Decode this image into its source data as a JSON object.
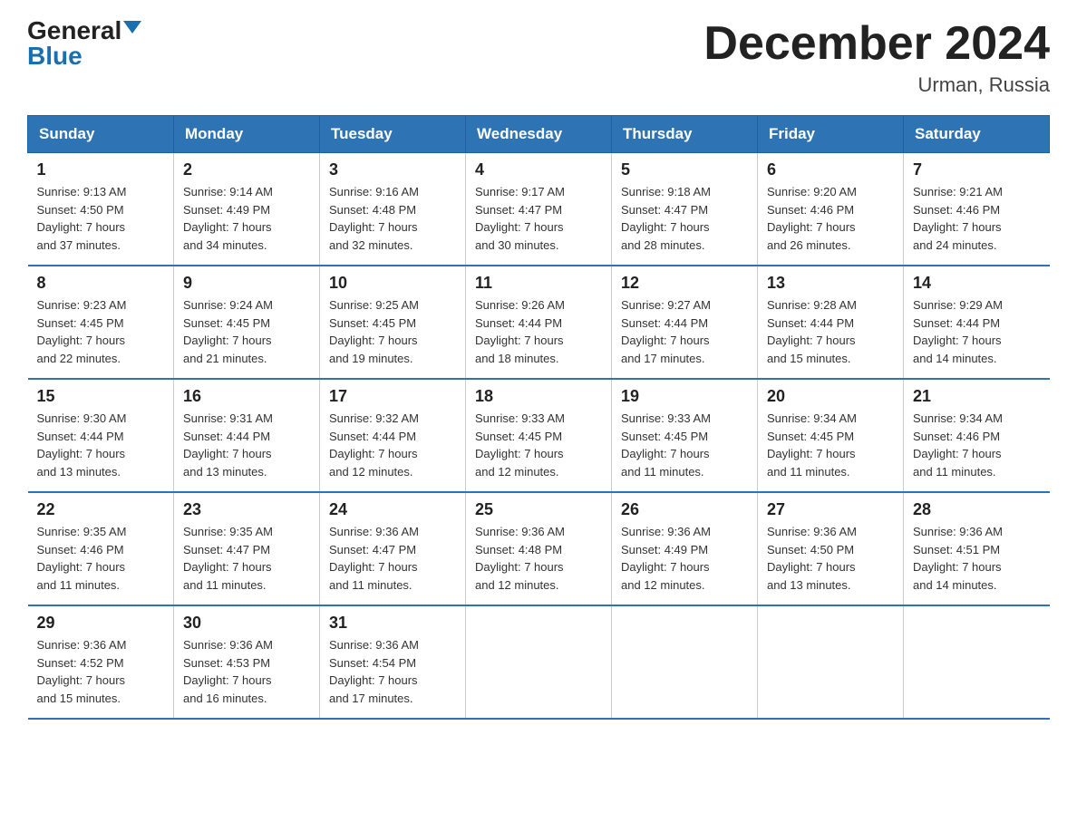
{
  "header": {
    "logo_general": "General",
    "logo_blue": "Blue",
    "month_title": "December 2024",
    "location": "Urman, Russia"
  },
  "weekdays": [
    "Sunday",
    "Monday",
    "Tuesday",
    "Wednesday",
    "Thursday",
    "Friday",
    "Saturday"
  ],
  "weeks": [
    [
      {
        "day": "1",
        "info": "Sunrise: 9:13 AM\nSunset: 4:50 PM\nDaylight: 7 hours\nand 37 minutes."
      },
      {
        "day": "2",
        "info": "Sunrise: 9:14 AM\nSunset: 4:49 PM\nDaylight: 7 hours\nand 34 minutes."
      },
      {
        "day": "3",
        "info": "Sunrise: 9:16 AM\nSunset: 4:48 PM\nDaylight: 7 hours\nand 32 minutes."
      },
      {
        "day": "4",
        "info": "Sunrise: 9:17 AM\nSunset: 4:47 PM\nDaylight: 7 hours\nand 30 minutes."
      },
      {
        "day": "5",
        "info": "Sunrise: 9:18 AM\nSunset: 4:47 PM\nDaylight: 7 hours\nand 28 minutes."
      },
      {
        "day": "6",
        "info": "Sunrise: 9:20 AM\nSunset: 4:46 PM\nDaylight: 7 hours\nand 26 minutes."
      },
      {
        "day": "7",
        "info": "Sunrise: 9:21 AM\nSunset: 4:46 PM\nDaylight: 7 hours\nand 24 minutes."
      }
    ],
    [
      {
        "day": "8",
        "info": "Sunrise: 9:23 AM\nSunset: 4:45 PM\nDaylight: 7 hours\nand 22 minutes."
      },
      {
        "day": "9",
        "info": "Sunrise: 9:24 AM\nSunset: 4:45 PM\nDaylight: 7 hours\nand 21 minutes."
      },
      {
        "day": "10",
        "info": "Sunrise: 9:25 AM\nSunset: 4:45 PM\nDaylight: 7 hours\nand 19 minutes."
      },
      {
        "day": "11",
        "info": "Sunrise: 9:26 AM\nSunset: 4:44 PM\nDaylight: 7 hours\nand 18 minutes."
      },
      {
        "day": "12",
        "info": "Sunrise: 9:27 AM\nSunset: 4:44 PM\nDaylight: 7 hours\nand 17 minutes."
      },
      {
        "day": "13",
        "info": "Sunrise: 9:28 AM\nSunset: 4:44 PM\nDaylight: 7 hours\nand 15 minutes."
      },
      {
        "day": "14",
        "info": "Sunrise: 9:29 AM\nSunset: 4:44 PM\nDaylight: 7 hours\nand 14 minutes."
      }
    ],
    [
      {
        "day": "15",
        "info": "Sunrise: 9:30 AM\nSunset: 4:44 PM\nDaylight: 7 hours\nand 13 minutes."
      },
      {
        "day": "16",
        "info": "Sunrise: 9:31 AM\nSunset: 4:44 PM\nDaylight: 7 hours\nand 13 minutes."
      },
      {
        "day": "17",
        "info": "Sunrise: 9:32 AM\nSunset: 4:44 PM\nDaylight: 7 hours\nand 12 minutes."
      },
      {
        "day": "18",
        "info": "Sunrise: 9:33 AM\nSunset: 4:45 PM\nDaylight: 7 hours\nand 12 minutes."
      },
      {
        "day": "19",
        "info": "Sunrise: 9:33 AM\nSunset: 4:45 PM\nDaylight: 7 hours\nand 11 minutes."
      },
      {
        "day": "20",
        "info": "Sunrise: 9:34 AM\nSunset: 4:45 PM\nDaylight: 7 hours\nand 11 minutes."
      },
      {
        "day": "21",
        "info": "Sunrise: 9:34 AM\nSunset: 4:46 PM\nDaylight: 7 hours\nand 11 minutes."
      }
    ],
    [
      {
        "day": "22",
        "info": "Sunrise: 9:35 AM\nSunset: 4:46 PM\nDaylight: 7 hours\nand 11 minutes."
      },
      {
        "day": "23",
        "info": "Sunrise: 9:35 AM\nSunset: 4:47 PM\nDaylight: 7 hours\nand 11 minutes."
      },
      {
        "day": "24",
        "info": "Sunrise: 9:36 AM\nSunset: 4:47 PM\nDaylight: 7 hours\nand 11 minutes."
      },
      {
        "day": "25",
        "info": "Sunrise: 9:36 AM\nSunset: 4:48 PM\nDaylight: 7 hours\nand 12 minutes."
      },
      {
        "day": "26",
        "info": "Sunrise: 9:36 AM\nSunset: 4:49 PM\nDaylight: 7 hours\nand 12 minutes."
      },
      {
        "day": "27",
        "info": "Sunrise: 9:36 AM\nSunset: 4:50 PM\nDaylight: 7 hours\nand 13 minutes."
      },
      {
        "day": "28",
        "info": "Sunrise: 9:36 AM\nSunset: 4:51 PM\nDaylight: 7 hours\nand 14 minutes."
      }
    ],
    [
      {
        "day": "29",
        "info": "Sunrise: 9:36 AM\nSunset: 4:52 PM\nDaylight: 7 hours\nand 15 minutes."
      },
      {
        "day": "30",
        "info": "Sunrise: 9:36 AM\nSunset: 4:53 PM\nDaylight: 7 hours\nand 16 minutes."
      },
      {
        "day": "31",
        "info": "Sunrise: 9:36 AM\nSunset: 4:54 PM\nDaylight: 7 hours\nand 17 minutes."
      },
      {
        "day": "",
        "info": ""
      },
      {
        "day": "",
        "info": ""
      },
      {
        "day": "",
        "info": ""
      },
      {
        "day": "",
        "info": ""
      }
    ]
  ]
}
